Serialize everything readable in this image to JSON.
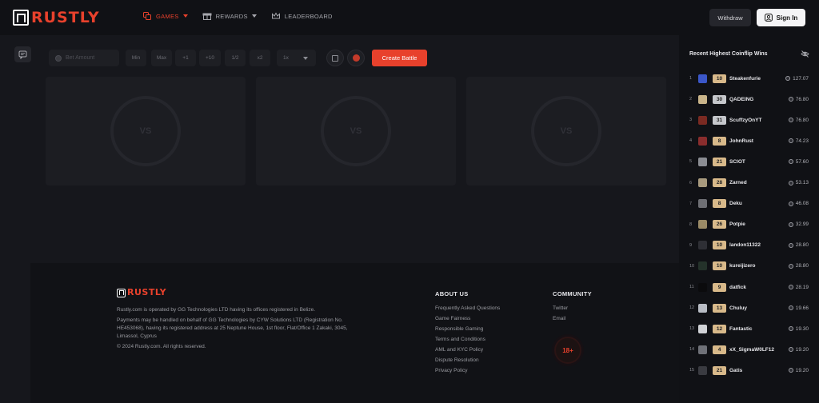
{
  "header": {
    "logo": "RUSTLY",
    "nav": [
      {
        "label": "GAMES",
        "icon": "dice-icon",
        "active": true,
        "dropdown": true
      },
      {
        "label": "REWARDS",
        "icon": "gift-icon",
        "active": false,
        "dropdown": true
      },
      {
        "label": "LEADERBOARD",
        "icon": "crown-icon",
        "active": false,
        "dropdown": false
      }
    ],
    "withdraw_label": "Withdraw",
    "signin_label": "Sign In"
  },
  "controls": {
    "bet_placeholder": "Bet Amount",
    "chips": [
      "Min",
      "Max",
      "+1",
      "+10",
      "1/2",
      "x2"
    ],
    "multiplier": "1x",
    "create_label": "Create Battle"
  },
  "battles": [
    {
      "label": "VS"
    },
    {
      "label": "VS"
    },
    {
      "label": "VS"
    }
  ],
  "footer": {
    "logo": "RUSTLY",
    "line1": "Rustly.com is operated by GG Technologies LTD having its offices registered in Belize.",
    "line2a": "Payments may be handled on behalf of GG Technologies by CYW Solutions LTD (Registration No.",
    "line2b": "HE453068), having its registered address at 25 Neptune House, 1st floor, Flat/Office 1 Zakaki, 3045,",
    "line2c": "Limassol, Cyprus",
    "copyright": "© 2024 Rustly.com. All rights reserved.",
    "about_title": "ABOUT US",
    "about_links": [
      "Frequently Asked Questions",
      "Game Fairness",
      "Responsible Gaming",
      "Terms and Conditions",
      "AML and KYC Policy",
      "Dispute Resolution",
      "Privacy Policy"
    ],
    "community_title": "COMMUNITY",
    "community_links": [
      "Twitter",
      "Email"
    ],
    "age_badge": "18+"
  },
  "sidebar": {
    "title": "Recent Highest Coinflip Wins",
    "wins": [
      {
        "rank": "1",
        "level": "10",
        "tier": "gold",
        "name": "Steakenfurie",
        "amount": "127.07",
        "avatar": "#3b57c9"
      },
      {
        "rank": "2",
        "level": "30",
        "tier": "silver",
        "name": "QADEING",
        "amount": "76.80",
        "avatar": "#c9b48a"
      },
      {
        "rank": "3",
        "level": "31",
        "tier": "silver",
        "name": "ScuffzyOnYT",
        "amount": "76.80",
        "avatar": "#7a2a22"
      },
      {
        "rank": "4",
        "level": "8",
        "tier": "gold",
        "name": "JohnRust",
        "amount": "74.23",
        "avatar": "#8a2d2d"
      },
      {
        "rank": "5",
        "level": "21",
        "tier": "gold",
        "name": "SCIOT",
        "amount": "57.60",
        "avatar": "#8b8d93"
      },
      {
        "rank": "6",
        "level": "28",
        "tier": "gold",
        "name": "Zarned",
        "amount": "53.13",
        "avatar": "#a89a7e"
      },
      {
        "rank": "7",
        "level": "8",
        "tier": "gold",
        "name": "Deku",
        "amount": "46.08",
        "avatar": "#6e6f74"
      },
      {
        "rank": "8",
        "level": "26",
        "tier": "gold",
        "name": "Potpie",
        "amount": "32.99",
        "avatar": "#9a8a66"
      },
      {
        "rank": "9",
        "level": "10",
        "tier": "gold",
        "name": "landon11322",
        "amount": "28.80",
        "avatar": "#2e2f35"
      },
      {
        "rank": "10",
        "level": "10",
        "tier": "gold",
        "name": "kureijizero",
        "amount": "28.80",
        "avatar": "#24322a"
      },
      {
        "rank": "11",
        "level": "9",
        "tier": "gold",
        "name": "datfick",
        "amount": "28.19",
        "avatar": "#0b0b0d"
      },
      {
        "rank": "12",
        "level": "13",
        "tier": "gold",
        "name": "Chuluy",
        "amount": "19.66",
        "avatar": "#b8bcc4"
      },
      {
        "rank": "13",
        "level": "12",
        "tier": "gold",
        "name": "Fantastic",
        "amount": "19.30",
        "avatar": "#d0d2d6"
      },
      {
        "rank": "14",
        "level": "4",
        "tier": "gold",
        "name": "xX_SigmaW0LF12",
        "amount": "19.20",
        "avatar": "#6f7178"
      },
      {
        "rank": "15",
        "level": "21",
        "tier": "gold",
        "name": "Gatis",
        "amount": "19.20",
        "avatar": "#3a3b41"
      }
    ]
  },
  "colors": {
    "accent": "#e8412c",
    "background": "#16171c",
    "gold_badge": "#d8b98a",
    "silver_badge": "#c6c8cc"
  }
}
